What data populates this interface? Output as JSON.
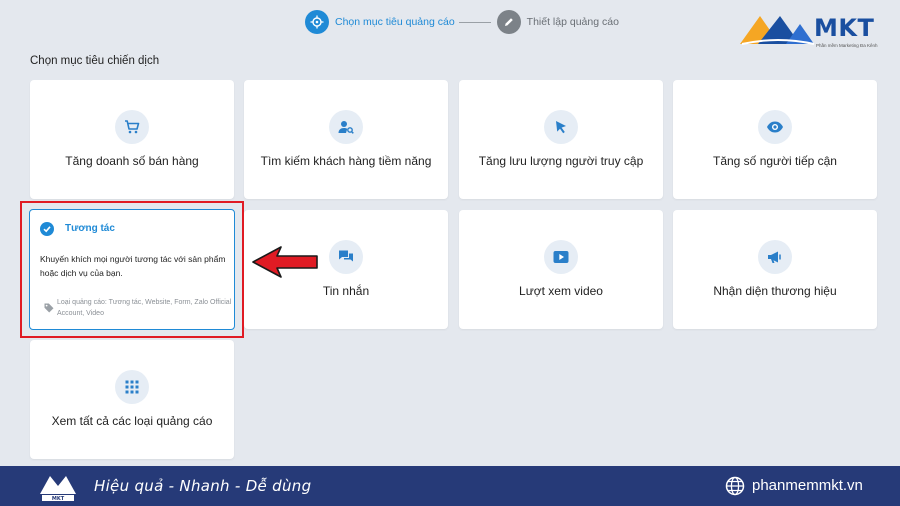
{
  "stepper": {
    "steps": [
      {
        "label": "Chọn mục tiêu quảng cáo",
        "state": "active",
        "icon": "target-icon"
      },
      {
        "label": "Thiết lập quảng cáo",
        "state": "inactive",
        "icon": "pencil-icon"
      }
    ]
  },
  "brand": {
    "name": "MKT",
    "tagline": "Phần mềm Marketing Đa Kênh",
    "primary_color": "#1a4fa0",
    "accent_color": "#f5a623"
  },
  "section_title": "Chọn mục tiêu chiến dịch",
  "cards": [
    {
      "label": "Tăng doanh số bán hàng",
      "icon": "cart-icon"
    },
    {
      "label": "Tìm kiếm khách hàng tiềm năng",
      "icon": "person-search-icon"
    },
    {
      "label": "Tăng lưu lượng người truy cập",
      "icon": "cursor-icon"
    },
    {
      "label": "Tăng số người tiếp cận",
      "icon": "eye-icon"
    },
    {
      "label": "Tin nhắn",
      "icon": "chat-icon"
    },
    {
      "label": "Lượt xem video",
      "icon": "play-icon"
    },
    {
      "label": "Nhận diện thương hiệu",
      "icon": "megaphone-icon"
    },
    {
      "label": "Xem tất cả các loại quảng cáo",
      "icon": "grid-icon"
    }
  ],
  "selected_card": {
    "title": "Tương tác",
    "description": "Khuyến khích mọi người tương tác với sản phẩm hoặc dịch vụ của bạn.",
    "ad_types": "Loại quảng cáo: Tương tác, Website, Form, Zalo Official Account, Video",
    "icon": "check-circle-icon",
    "accent_color": "#1f8ad6"
  },
  "annotation": {
    "color": "#e01b24"
  },
  "footer": {
    "tagline": "Hiệu quả - Nhanh - Dễ dùng",
    "url": "phanmemmkt.vn",
    "background": "#263a78"
  }
}
